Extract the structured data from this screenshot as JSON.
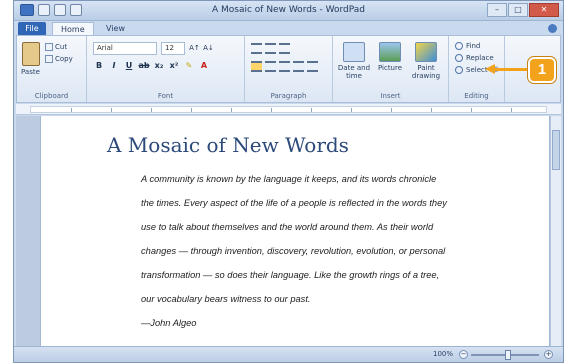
{
  "window": {
    "title": "A Mosaic of New Words - WordPad"
  },
  "tabs": [
    {
      "label": "File"
    },
    {
      "label": "Home"
    },
    {
      "label": "View"
    }
  ],
  "ribbon": {
    "clipboard": {
      "paste_label": "Paste",
      "cut_label": "Cut",
      "copy_label": "Copy",
      "group_label": "Clipboard"
    },
    "font": {
      "font_name": "Arial",
      "font_size": "12",
      "group_label": "Font"
    },
    "paragraph": {
      "group_label": "Paragraph"
    },
    "insert": {
      "date_time_label": "Date and time",
      "picture_label": "Picture",
      "paint_label": "Paint drawing",
      "group_label": "Insert"
    },
    "editing": {
      "find_label": "Find",
      "replace_label": "Replace",
      "select_all_label": "Select all",
      "group_label": "Editing"
    }
  },
  "callout": {
    "number": "1",
    "color": "#f3a21b"
  },
  "document": {
    "title": "A Mosaic of New Words",
    "lines": [
      "A community is known by the language it keeps, and its words chronicle",
      "the times. Every aspect of the life of a people is reflected in the words they",
      "use to talk about themselves and the world around them. As their world",
      "changes — through invention, discovery, revolution, evolution, or personal",
      "transformation — so does their language. Like the growth rings of a tree,",
      "our vocabulary bears witness to our past.",
      "—John Algeo"
    ]
  },
  "status": {
    "zoom": "100%"
  }
}
